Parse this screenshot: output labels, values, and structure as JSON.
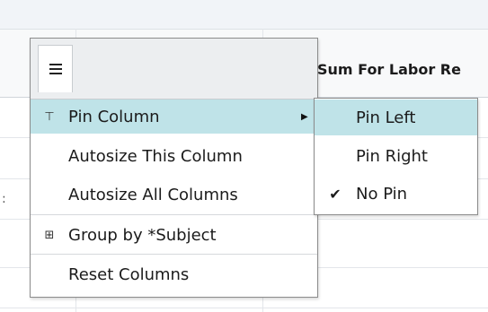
{
  "grid": {
    "column_header": "Sum For Labor Re",
    "edge_mark": ":",
    "bottom_fragment": "."
  },
  "column_menu": {
    "tab_icon": "hamburger-icon",
    "items": [
      {
        "label": "Pin Column",
        "icon": "pin-icon",
        "icon_glyph": "⊤",
        "has_submenu": true,
        "active": true
      },
      {
        "label": "Autosize This Column",
        "icon": "",
        "icon_glyph": ""
      },
      {
        "label": "Autosize All Columns",
        "icon": "",
        "icon_glyph": ""
      },
      {
        "label": "Group by *Subject",
        "icon": "group-icon",
        "icon_glyph": "⊞"
      },
      {
        "label": "Reset Columns",
        "icon": "",
        "icon_glyph": ""
      }
    ],
    "submenu_arrow": "▶"
  },
  "pin_submenu": {
    "items": [
      {
        "label": "Pin Left",
        "checked": false,
        "active": true
      },
      {
        "label": "Pin Right",
        "checked": false
      },
      {
        "label": "No Pin",
        "checked": true
      }
    ],
    "check_glyph": "✔"
  },
  "colors": {
    "active_row": "#bfe3e8",
    "menu_border": "#8c8c8c",
    "tabbar": "#eceef0"
  }
}
